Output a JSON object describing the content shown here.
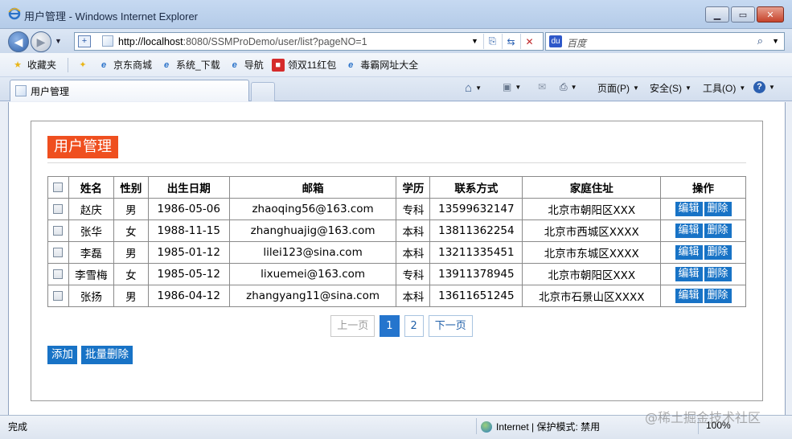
{
  "window": {
    "title": "用户管理 - Windows Internet Explorer"
  },
  "address": {
    "url_host": "http://localhost",
    "url_rest": ":8080/SSMProDemo/user/list?pageNO=1",
    "search_placeholder": "百度"
  },
  "favorites": {
    "label": "收藏夹",
    "items": [
      "京东商城",
      "系统_下载",
      "导航",
      "领双11红包",
      "毒霸网址大全"
    ]
  },
  "tab": {
    "label": "用户管理"
  },
  "commands": {
    "page": "页面(P)",
    "safety": "安全(S)",
    "tools": "工具(O)"
  },
  "page": {
    "title": "用户管理",
    "columns": [
      "姓名",
      "性别",
      "出生日期",
      "邮箱",
      "学历",
      "联系方式",
      "家庭住址",
      "操作"
    ],
    "rows": [
      [
        "赵庆",
        "男",
        "1986-05-06",
        "zhaoqing56@163.com",
        "专科",
        "13599632147",
        "北京市朝阳区XXX"
      ],
      [
        "张华",
        "女",
        "1988-11-15",
        "zhanghuajig@163.com",
        "本科",
        "13811362254",
        "北京市西城区XXXX"
      ],
      [
        "李磊",
        "男",
        "1985-01-12",
        "lilei123@sina.com",
        "本科",
        "13211335451",
        "北京市东城区XXXX"
      ],
      [
        "李雪梅",
        "女",
        "1985-05-12",
        "lixuemei@163.com",
        "专科",
        "13911378945",
        "北京市朝阳区XXX"
      ],
      [
        "张扬",
        "男",
        "1986-04-12",
        "zhangyang11@sina.com",
        "本科",
        "13611651245",
        "北京市石景山区XXXX"
      ]
    ],
    "row_actions": {
      "edit": "编辑",
      "delete": "删除"
    },
    "pager": {
      "prev": "上一页",
      "pages": [
        "1",
        "2"
      ],
      "current": "1",
      "next": "下一页"
    },
    "buttons": {
      "add": "添加",
      "batch_delete": "批量删除"
    }
  },
  "status": {
    "text": "完成",
    "zone": "Internet | 保护模式: 禁用",
    "zoom": "100%"
  },
  "watermark": "@稀土掘金技术社区",
  "colors": {
    "title_badge": "#ef4f1f",
    "button": "#1873c6",
    "pager_active": "#2575cd"
  }
}
